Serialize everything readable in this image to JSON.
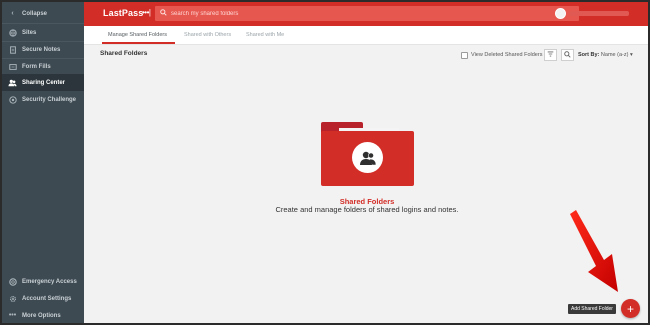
{
  "sidebar": {
    "items": [
      {
        "label": "Collapse",
        "icon": "chevron-left-icon"
      },
      {
        "label": "Sites",
        "icon": "globe-icon"
      },
      {
        "label": "Secure Notes",
        "icon": "note-icon"
      },
      {
        "label": "Form Fills",
        "icon": "form-icon"
      },
      {
        "label": "Sharing Center",
        "icon": "people-icon",
        "active": true
      },
      {
        "label": "Security Challenge",
        "icon": "shield-icon"
      }
    ],
    "bottom_items": [
      {
        "label": "Emergency Access",
        "icon": "life-ring-icon"
      },
      {
        "label": "Account Settings",
        "icon": "gear-icon"
      },
      {
        "label": "More Options",
        "icon": "ellipsis-icon"
      }
    ]
  },
  "header": {
    "logo": "LastPass",
    "logo_dots": "•••|",
    "search_placeholder": "search my shared folders",
    "brand_color": "#d32d27"
  },
  "tabs": [
    {
      "label": "Manage Shared Folders",
      "active": true
    },
    {
      "label": "Shared with Others"
    },
    {
      "label": "Shared with Me"
    }
  ],
  "main": {
    "section_title": "Shared Folders",
    "view_deleted_label": "View Deleted Shared Folders",
    "sort_label": "Sort By:",
    "sort_value": "Name (a-z)",
    "empty_title": "Shared Folders",
    "empty_desc": "Create and manage folders of shared logins and notes."
  },
  "fab": {
    "tooltip": "Add Shared Folder",
    "symbol": "+"
  }
}
